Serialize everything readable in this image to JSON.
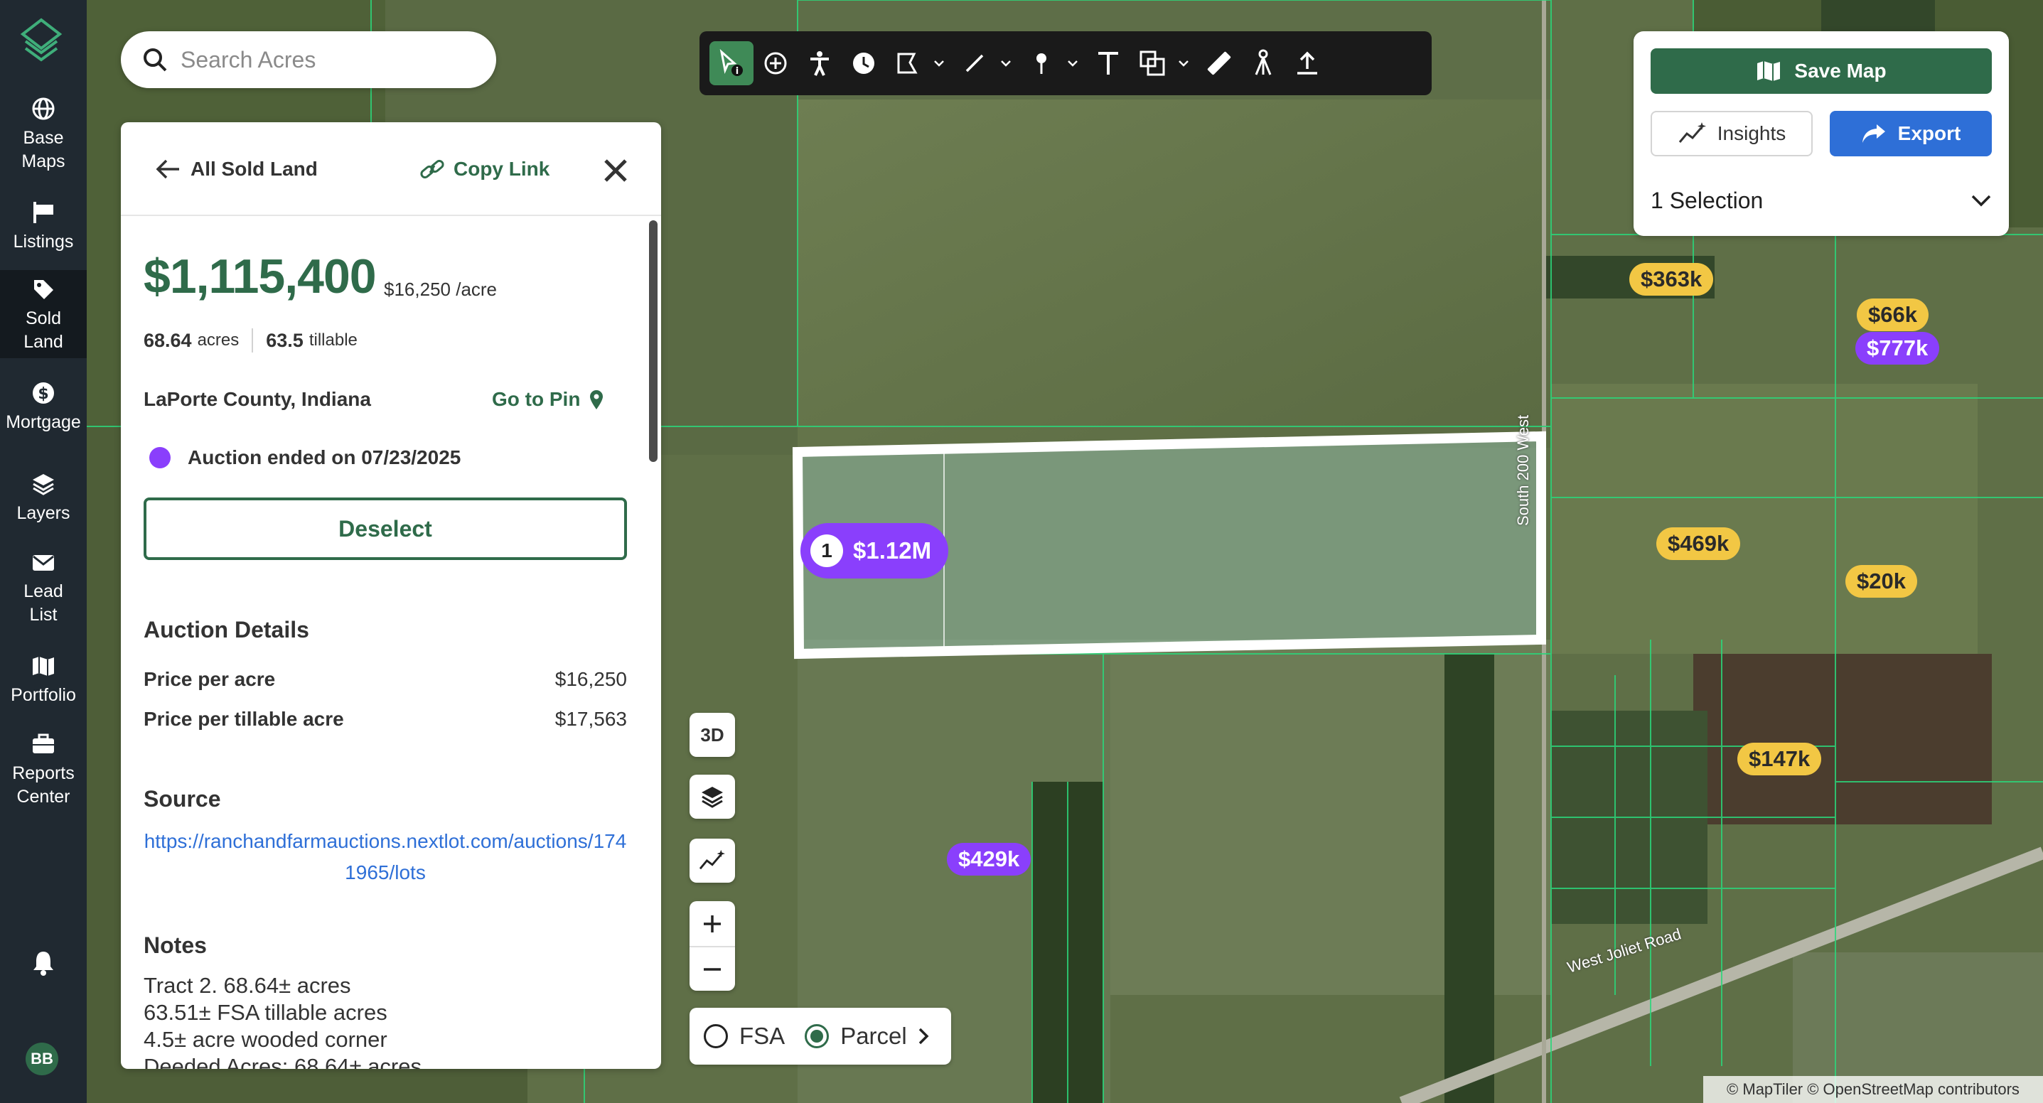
{
  "nav": {
    "items": [
      {
        "label": "Base\nMaps",
        "icon": "globe-icon"
      },
      {
        "label": "Listings",
        "icon": "sign-icon"
      },
      {
        "label": "Sold\nLand",
        "icon": "tag-icon"
      },
      {
        "label": "Mortgage",
        "icon": "dollar-icon"
      },
      {
        "label": "Layers",
        "icon": "layers-icon"
      },
      {
        "label": "Lead\nList",
        "icon": "mail-icon"
      },
      {
        "label": "Portfolio",
        "icon": "map-icon"
      },
      {
        "label": "Reports\nCenter",
        "icon": "briefcase-icon"
      }
    ],
    "active": "Sold Land",
    "avatar_initials": "BB"
  },
  "search": {
    "placeholder": "Search Acres"
  },
  "actions": {
    "save_label": "Save Map",
    "insights_label": "Insights",
    "export_label": "Export",
    "selection_label": "1 Selection"
  },
  "panel": {
    "back_label": "All Sold Land",
    "copy_label": "Copy Link",
    "price": "$1,115,400",
    "price_per_acre": "$16,250",
    "per_acre_unit": "/acre",
    "acres": "68.64",
    "acres_unit": "acres",
    "tillable": "63.5",
    "tillable_unit": "tillable",
    "county": "LaPorte County, Indiana",
    "go_to_pin": "Go to Pin",
    "auction_status": "Auction ended on 07/23/2025",
    "deselect_label": "Deselect",
    "auction_details_title": "Auction Details",
    "details": [
      {
        "k": "Price per acre",
        "v": "$16,250"
      },
      {
        "k": "Price per tillable acre",
        "v": "$17,563"
      }
    ],
    "source_title": "Source",
    "source_url": "https://ranchandfarmauctions.nextlot.com/auctions/1741965/lots",
    "notes_title": "Notes",
    "notes": "Tract 2. 68.64± acres\n63.51± FSA tillable acres\n4.5± acre wooded corner\nDeeded Acres: 68.64± acres"
  },
  "map": {
    "selected_pin": {
      "num": "1",
      "price": "$1.12M"
    },
    "pins": [
      {
        "label": "$363k",
        "color": "yellow"
      },
      {
        "label": "$66k",
        "color": "yellow"
      },
      {
        "label": "$777k",
        "color": "purple"
      },
      {
        "label": "$469k",
        "color": "yellow"
      },
      {
        "label": "$20k",
        "color": "yellow"
      },
      {
        "label": "$147k",
        "color": "yellow"
      },
      {
        "label": "$429k",
        "color": "purple"
      }
    ],
    "roads": [
      "South 200 West",
      "West Joliet Road"
    ],
    "controls": {
      "three_d": "3D",
      "fsa": "FSA",
      "parcel": "Parcel"
    },
    "attribution": "© MapTiler © OpenStreetMap contributors"
  },
  "colors": {
    "brand_green": "#2f6b4a",
    "export_blue": "#2e6fd7",
    "sold_purple": "#8a3ffc",
    "listing_yellow": "#f2c744",
    "nav_bg": "#202931"
  }
}
